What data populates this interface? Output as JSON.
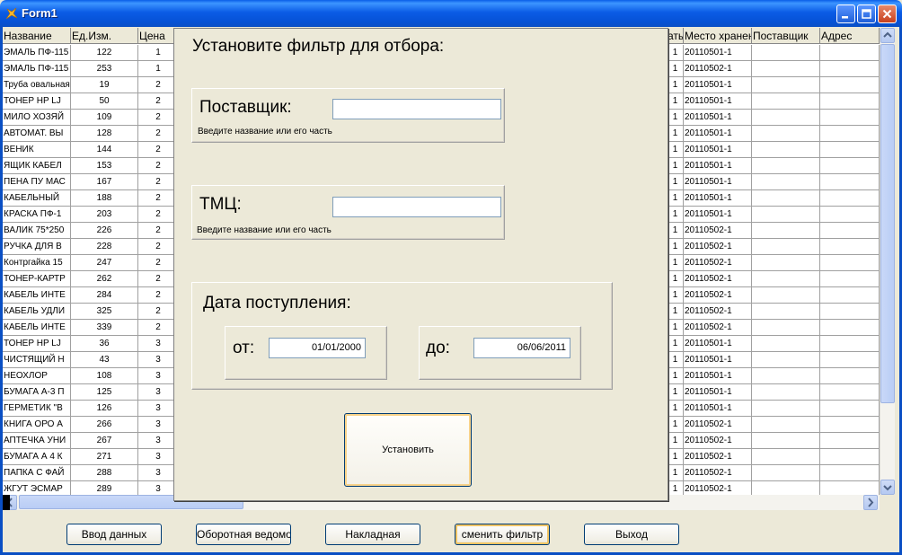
{
  "window": {
    "title": "Form1"
  },
  "grid": {
    "left_columns": [
      "Название",
      "Ед.Изм.",
      "Цена"
    ],
    "right_columns": [
      "аты",
      "Место хранения",
      "Поставщик",
      "Адрес"
    ],
    "rows": [
      {
        "name": "ЭМАЛЬ ПФ-115",
        "unit": "122",
        "price": "1",
        "col4": "1",
        "storage": "20110501-1"
      },
      {
        "name": "ЭМАЛЬ ПФ-115",
        "unit": "253",
        "price": "1",
        "col4": "1",
        "storage": "20110502-1"
      },
      {
        "name": "Труба овальная",
        "unit": "19",
        "price": "2",
        "col4": "1",
        "storage": "20110501-1"
      },
      {
        "name": "ТОНЕР HP LJ",
        "unit": "50",
        "price": "2",
        "col4": "1",
        "storage": "20110501-1"
      },
      {
        "name": "МИЛО ХОЗЯЙ",
        "unit": "109",
        "price": "2",
        "col4": "1",
        "storage": "20110501-1"
      },
      {
        "name": "АВТОМАТ. ВЫ",
        "unit": "128",
        "price": "2",
        "col4": "1",
        "storage": "20110501-1"
      },
      {
        "name": "ВЕНИК",
        "unit": "144",
        "price": "2",
        "col4": "1",
        "storage": "20110501-1"
      },
      {
        "name": "ЯЩИК КАБЕЛ",
        "unit": "153",
        "price": "2",
        "col4": "1",
        "storage": "20110501-1"
      },
      {
        "name": "ПЕНА ПУ МАС",
        "unit": "167",
        "price": "2",
        "col4": "1",
        "storage": "20110501-1"
      },
      {
        "name": "КАБЕЛЬНЫЙ",
        "unit": "188",
        "price": "2",
        "col4": "1",
        "storage": "20110501-1"
      },
      {
        "name": "КРАСКА ПФ-1",
        "unit": "203",
        "price": "2",
        "col4": "1",
        "storage": "20110501-1"
      },
      {
        "name": "ВАЛИК 75*250",
        "unit": "226",
        "price": "2",
        "col4": "1",
        "storage": "20110502-1"
      },
      {
        "name": "РУЧКА ДЛЯ В",
        "unit": "228",
        "price": "2",
        "col4": "1",
        "storage": "20110502-1"
      },
      {
        "name": "Контргайка 15",
        "unit": "247",
        "price": "2",
        "col4": "1",
        "storage": "20110502-1"
      },
      {
        "name": "ТОНЕР-КАРТР",
        "unit": "262",
        "price": "2",
        "col4": "1",
        "storage": "20110502-1"
      },
      {
        "name": "КАБЕЛЬ ИНТЕ",
        "unit": "284",
        "price": "2",
        "col4": "1",
        "storage": "20110502-1"
      },
      {
        "name": "КАБЕЛЬ УДЛИ",
        "unit": "325",
        "price": "2",
        "col4": "1",
        "storage": "20110502-1"
      },
      {
        "name": "КАБЕЛЬ ИНТЕ",
        "unit": "339",
        "price": "2",
        "col4": "1",
        "storage": "20110502-1"
      },
      {
        "name": "ТОНЕР HP LJ",
        "unit": "36",
        "price": "3",
        "col4": "1",
        "storage": "20110501-1"
      },
      {
        "name": "ЧИСТЯЩИЙ Н",
        "unit": "43",
        "price": "3",
        "col4": "1",
        "storage": "20110501-1"
      },
      {
        "name": "НЕОХЛОР",
        "unit": "108",
        "price": "3",
        "col4": "1",
        "storage": "20110501-1"
      },
      {
        "name": "БУМАГА А-3 П",
        "unit": "125",
        "price": "3",
        "col4": "1",
        "storage": "20110501-1"
      },
      {
        "name": "ГЕРМЕТИК \"В",
        "unit": "126",
        "price": "3",
        "col4": "1",
        "storage": "20110501-1"
      },
      {
        "name": "КНИГА ОРО А",
        "unit": "266",
        "price": "3",
        "col4": "1",
        "storage": "20110502-1"
      },
      {
        "name": "АПТЕЧКА УНИ",
        "unit": "267",
        "price": "3",
        "col4": "1",
        "storage": "20110502-1"
      },
      {
        "name": "БУМАГА А 4 К",
        "unit": "271",
        "price": "3",
        "col4": "1",
        "storage": "20110502-1"
      },
      {
        "name": "ПАПКА С ФАЙ",
        "unit": "288",
        "price": "3",
        "col4": "1",
        "storage": "20110502-1"
      },
      {
        "name": "ЖГУТ ЭСМАР",
        "unit": "289",
        "price": "3",
        "col4": "1",
        "storage": "20110502-1"
      }
    ]
  },
  "filter": {
    "title": "Установите фильтр для отбора:",
    "supplier": {
      "label": "Поставщик:",
      "hint": "Введите название или его часть",
      "value": ""
    },
    "tmc": {
      "label": "ТМЦ:",
      "hint": "Введите название или его часть",
      "value": ""
    },
    "date": {
      "label": "Дата поступления:",
      "from_label": "от:",
      "from_value": "01/01/2000",
      "to_label": "до:",
      "to_value": "06/06/2011"
    },
    "apply_label": "Установить"
  },
  "buttons": {
    "input_data": "Ввод данных",
    "turnover": "Оборотная ведомость",
    "invoice": "Накладная",
    "change_filter": "сменить фильтр",
    "exit": "Выход"
  }
}
